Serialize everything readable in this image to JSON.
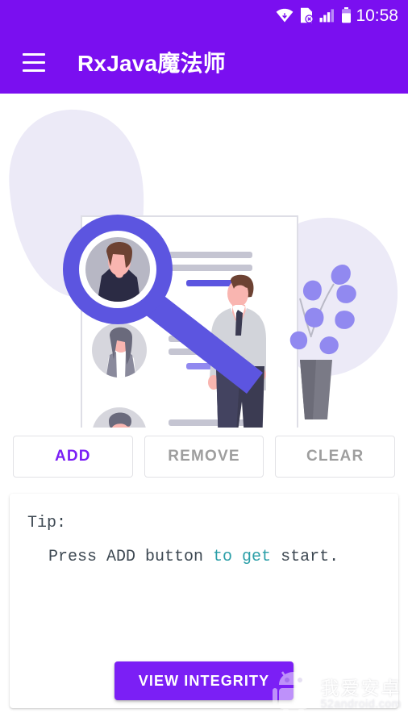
{
  "statusbar": {
    "time": "10:58",
    "icons": [
      "wifi-icon",
      "sim-card-error-icon",
      "cellular-signal-icon",
      "battery-icon"
    ]
  },
  "appbar": {
    "menu_icon": "hamburger-menu-icon",
    "title": "RxJava魔法师",
    "background_color": "#7a0ff0"
  },
  "illustration": {
    "name": "people-search-illustration",
    "alt": "Magnifying glass over a contact list document with a standing person and a potted plant",
    "colors": {
      "blob": "#eceaf7",
      "magnifier": "#5c55e0",
      "document": "#ffffff",
      "document_border": "#e4e4ea",
      "line_gray": "#c9c9d4",
      "line_purple": "#5c55e0",
      "skin": "#f9b5b0",
      "hair_dark": "#6d4233",
      "suit": "#3b3b52",
      "jacket": "#d2d4da",
      "leaf": "#9189f0",
      "pot": "#7a7a86"
    }
  },
  "actions": {
    "buttons": [
      {
        "label": "ADD",
        "state": "enabled"
      },
      {
        "label": "REMOVE",
        "state": "disabled"
      },
      {
        "label": "CLEAR",
        "state": "disabled"
      }
    ],
    "enabled_color": "#7b1ff5",
    "disabled_color": "#9e9e9e"
  },
  "tip_card": {
    "heading": "Tip:",
    "body_before": " Press ADD button ",
    "body_keyword": "to get",
    "body_after": " start.",
    "keyword_color": "#2b9fa8"
  },
  "bottom_action": {
    "label": "VIEW INTEGRITY",
    "color": "#7b1ff5"
  },
  "watermark": {
    "logo": "android-robot-icon",
    "chinese": "我爱安卓",
    "url": "52android.com"
  }
}
